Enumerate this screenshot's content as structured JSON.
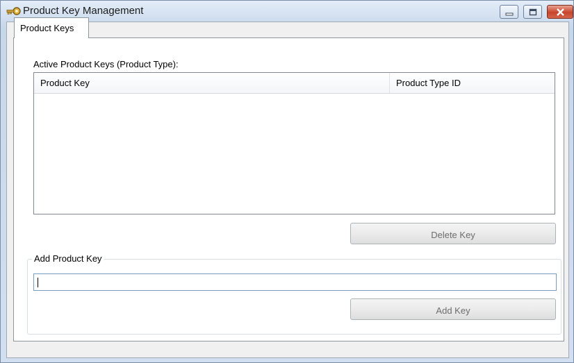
{
  "window": {
    "title": "Product Key Management",
    "icon": "key-icon",
    "controls": [
      "minimize-icon",
      "maximize-icon",
      "close-icon"
    ]
  },
  "tabs": [
    {
      "label": "Product Keys",
      "selected": true
    }
  ],
  "active_keys": {
    "label": "Active Product Keys (Product Type):",
    "columns": [
      "Product Key",
      "Product Type ID"
    ],
    "rows": []
  },
  "delete_button": {
    "label": "Delete Key",
    "enabled": false
  },
  "add_group": {
    "legend": "Add Product Key",
    "input_value": "",
    "add_button": {
      "label": "Add Key",
      "enabled": false
    }
  },
  "colors": {
    "title_bar": "#cddcee",
    "close_button": "#c7452c",
    "input_border": "#7a9ac0"
  }
}
